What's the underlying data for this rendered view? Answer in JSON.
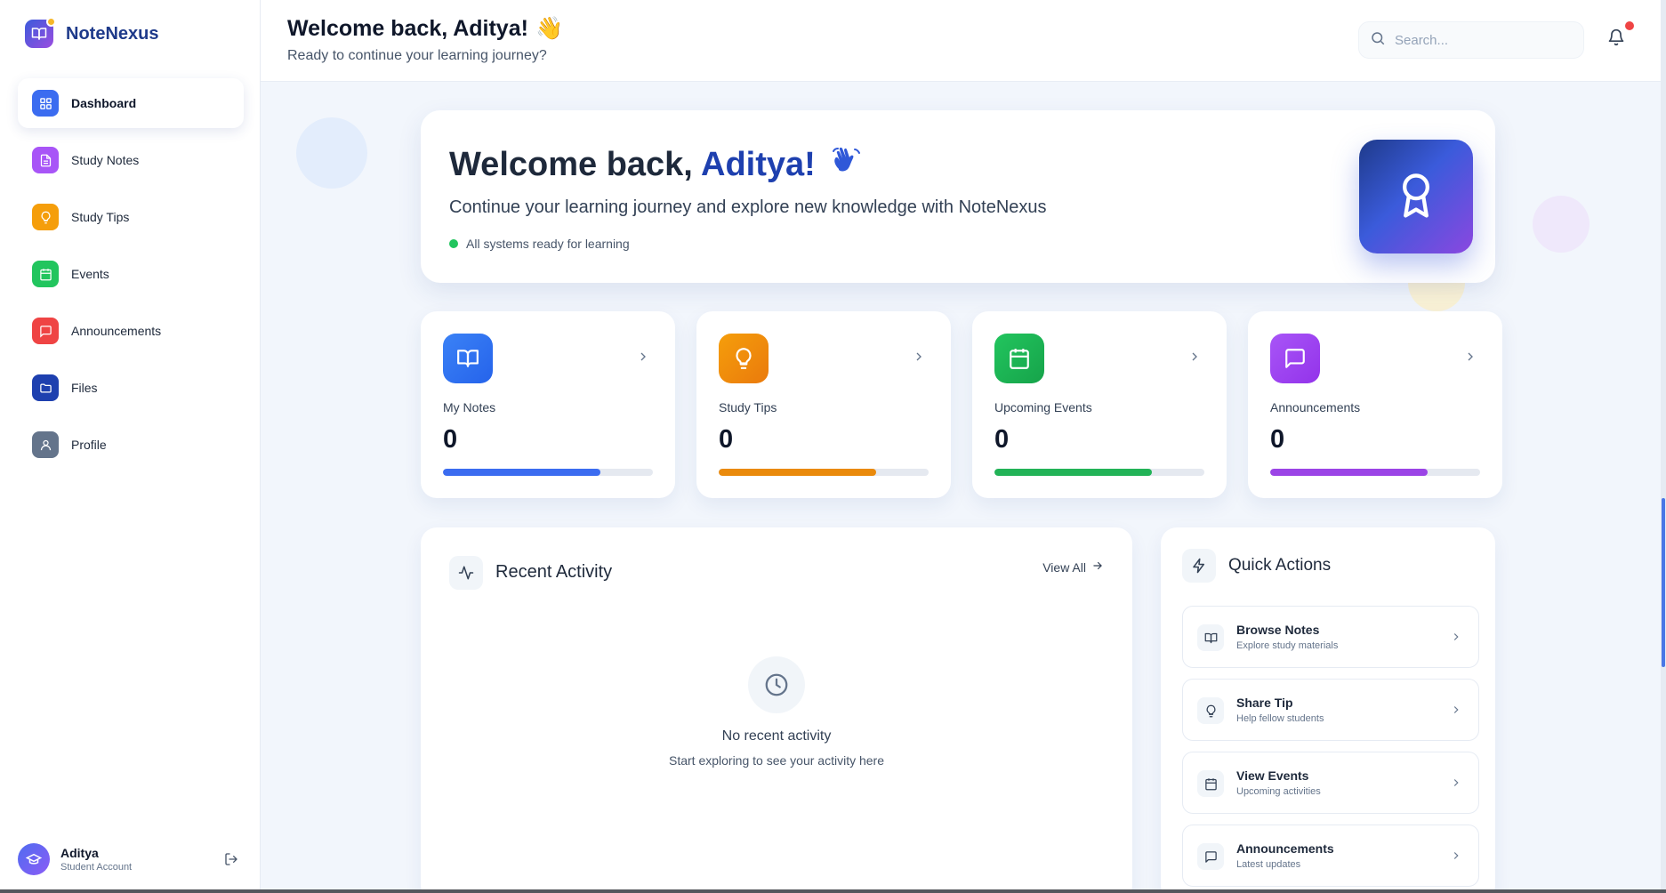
{
  "brand": {
    "name": "NoteNexus",
    "logo_icon": "book-open-icon"
  },
  "sidebar": {
    "items": [
      {
        "label": "Dashboard",
        "icon": "grid-icon",
        "color": "#3b6cf0",
        "active": true
      },
      {
        "label": "Study Notes",
        "icon": "file-text-icon",
        "color": "#a855f7"
      },
      {
        "label": "Study Tips",
        "icon": "lightbulb-icon",
        "color": "#f59e0b"
      },
      {
        "label": "Events",
        "icon": "calendar-icon",
        "color": "#22c55e"
      },
      {
        "label": "Announcements",
        "icon": "message-square-icon",
        "color": "#ef4444"
      },
      {
        "label": "Files",
        "icon": "folder-icon",
        "color": "#1e40af"
      },
      {
        "label": "Profile",
        "icon": "user-icon",
        "color": "#64748b"
      }
    ],
    "user": {
      "name": "Aditya",
      "role": "Student Account"
    }
  },
  "header": {
    "title": "Welcome back, Aditya!",
    "emoji": "👋",
    "subtitle": "Ready to continue your learning journey?",
    "search_placeholder": "Search...",
    "notification_badge_color": "#ef4444"
  },
  "hero": {
    "title_prefix": "Welcome back,",
    "title_name": "Aditya!",
    "emoji": "👋",
    "description": "Continue your learning journey and explore new knowledge with NoteNexus",
    "status": "All systems ready for learning",
    "badge_icon": "award-icon"
  },
  "stats": [
    {
      "label": "My Notes",
      "value": "0",
      "icon": "book-open-icon",
      "color": "#3b6cf0",
      "progress": 0.75
    },
    {
      "label": "Study Tips",
      "value": "0",
      "icon": "lightbulb-icon",
      "color": "#ea8a0c",
      "progress": 0.75
    },
    {
      "label": "Upcoming Events",
      "value": "0",
      "icon": "calendar-icon",
      "color": "#22b357",
      "progress": 0.75
    },
    {
      "label": "Announcements",
      "value": "0",
      "icon": "message-square-icon",
      "color": "#9b44e6",
      "progress": 0.75
    }
  ],
  "activity": {
    "title": "Recent Activity",
    "view_all": "View All",
    "empty_title": "No recent activity",
    "empty_subtitle": "Start exploring to see your activity here"
  },
  "quick_actions": {
    "title": "Quick Actions",
    "items": [
      {
        "title": "Browse Notes",
        "subtitle": "Explore study materials",
        "icon": "book-open-icon"
      },
      {
        "title": "Share Tip",
        "subtitle": "Help fellow students",
        "icon": "lightbulb-icon"
      },
      {
        "title": "View Events",
        "subtitle": "Upcoming activities",
        "icon": "calendar-icon"
      },
      {
        "title": "Announcements",
        "subtitle": "Latest updates",
        "icon": "message-square-icon"
      }
    ]
  }
}
